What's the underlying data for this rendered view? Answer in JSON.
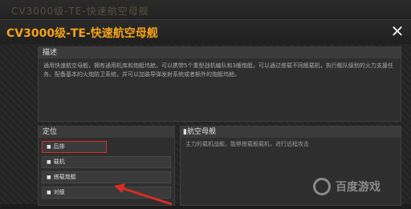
{
  "header_ghost": "CV3000级-TE-快速航空母舰",
  "dialog": {
    "title": "CV3000级-TE-快速航空母舰",
    "close_icon": "close-icon"
  },
  "description": {
    "label": "描述",
    "text": "通用快速航空母舰，拥有通用机库和炮艇坞舱，可以携带5个重型战机编队和3艘炮艇，可以通过搭载不同舰载机，执行舰队级别的火力支援任务。配备基本的火炮防卫系统，并可以加装导弹发射系统或者额外的炮艇坞舱。"
  },
  "roles": {
    "label": "定位",
    "items": [
      {
        "label": "后排",
        "selected": true
      },
      {
        "label": "载机",
        "selected": false
      },
      {
        "label": "搭载炮艇",
        "selected": false
      },
      {
        "label": "对舰",
        "selected": false
      }
    ]
  },
  "detail": {
    "label": "航空母舰",
    "text": "主力的载机战舰，能够搭载舰载机，进行远程攻击"
  },
  "watermark": "百度游戏",
  "colors": {
    "accent": "#f2a21a",
    "highlight": "#d62e26"
  }
}
